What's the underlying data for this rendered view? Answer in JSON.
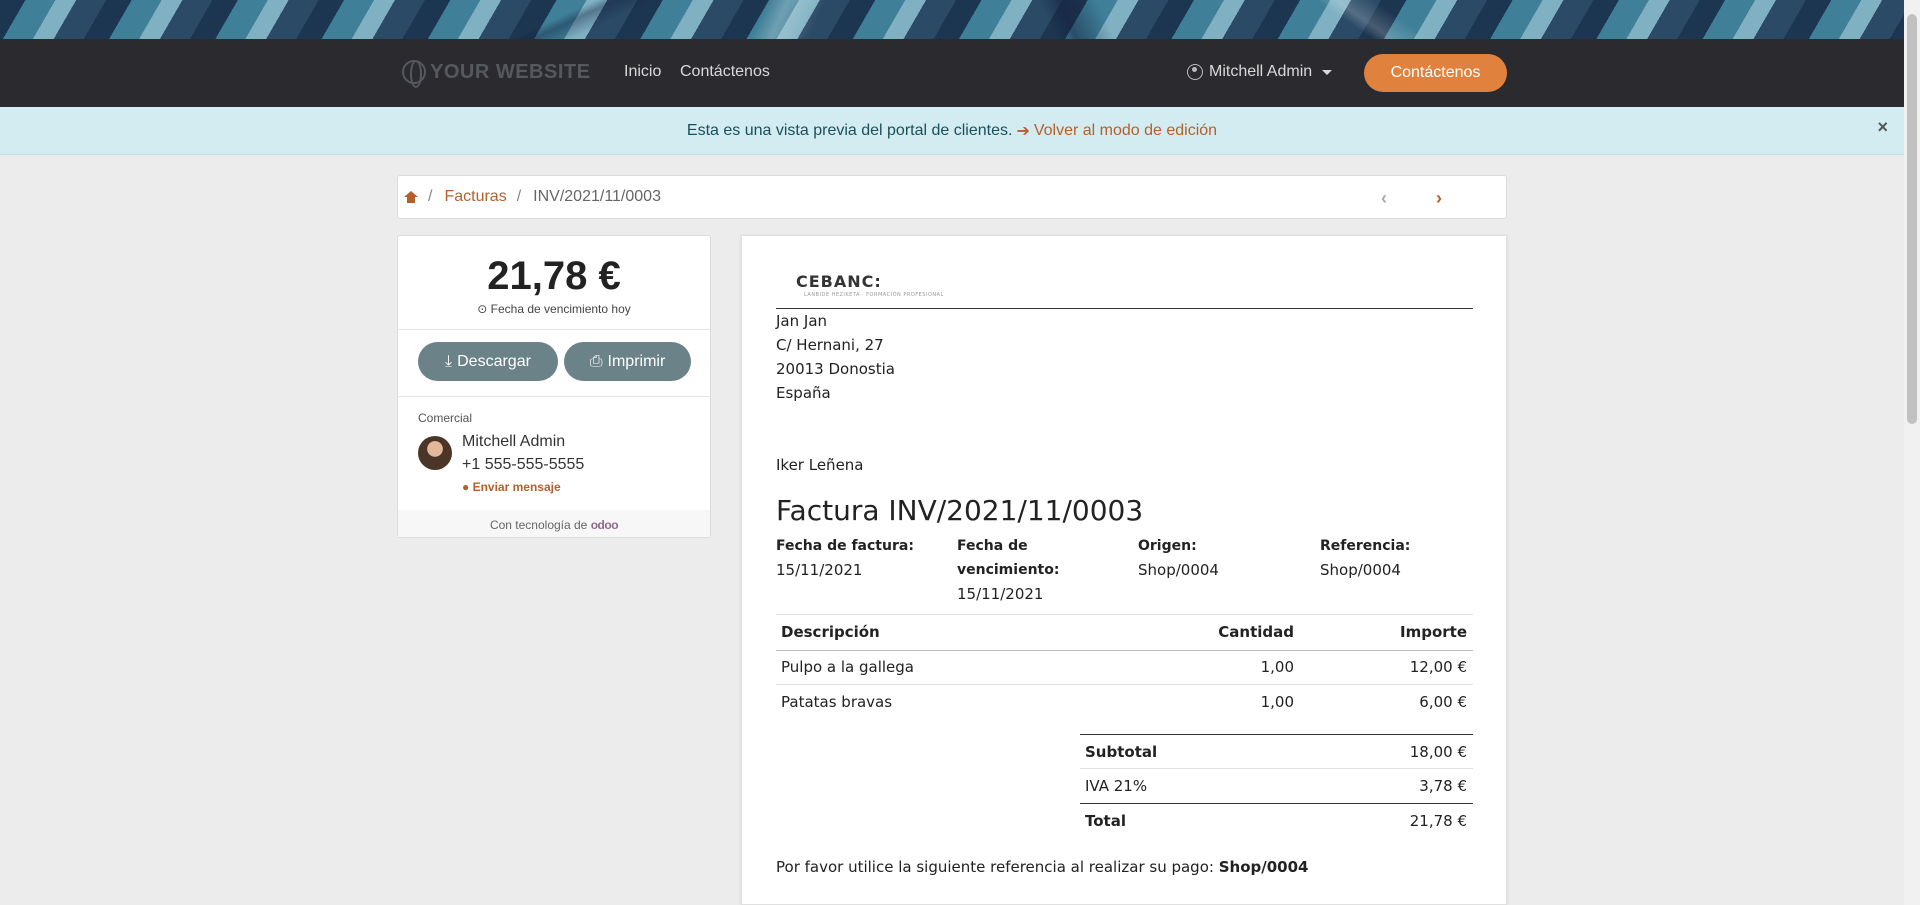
{
  "navbar": {
    "logo_text": "YOUR WEBSITE",
    "links": [
      "Inicio",
      "Contáctenos"
    ],
    "user_name": "Mitchell Admin",
    "cta_label": "Contáctenos"
  },
  "alert": {
    "text": "Esta es una vista previa del portal de clientes.",
    "link_text": "Volver al modo de edición",
    "close": "×"
  },
  "breadcrumb": {
    "sep": "/",
    "section": "Facturas",
    "current": "INV/2021/11/0003",
    "prev": "‹",
    "next": "›"
  },
  "sidebar": {
    "amount": "21,78 €",
    "due_text": "Fecha de vencimiento hoy",
    "download_label": "Descargar",
    "print_label": "Imprimir",
    "salesperson_heading": "Comercial",
    "salesperson_name": "Mitchell Admin",
    "salesperson_phone": "+1 555-555-5555",
    "message_label": "Enviar mensaje",
    "powered_by": "Con tecnología de",
    "powered_brand": "odoo"
  },
  "invoice": {
    "company_logo": "CEBANC:",
    "company_tagline": "LANBIDE HEZIKETA · FORMACIÓN PROFESIONAL",
    "company_address": [
      "Jan Jan",
      "C/ Hernani, 27",
      "20013 Donostia",
      "España"
    ],
    "customer": "Iker Leñena",
    "title": "Factura INV/2021/11/0003",
    "meta": {
      "invoice_date_label": "Fecha de factura:",
      "invoice_date": "15/11/2021",
      "due_date_label_1": "Fecha de",
      "due_date_label_2": "vencimiento:",
      "due_date": "15/11/2021",
      "origin_label": "Origen:",
      "origin": "Shop/0004",
      "reference_label": "Referencia:",
      "reference": "Shop/0004"
    },
    "columns": [
      "Descripción",
      "Cantidad",
      "Importe"
    ],
    "lines": [
      {
        "description": "Pulpo a la gallega",
        "quantity": "1,00",
        "amount": "12,00 €"
      },
      {
        "description": "Patatas bravas",
        "quantity": "1,00",
        "amount": "6,00 €"
      }
    ],
    "totals": {
      "subtotal_label": "Subtotal",
      "subtotal": "18,00 €",
      "tax_label": "IVA 21%",
      "tax": "3,78 €",
      "total_label": "Total",
      "total": "21,78 €"
    },
    "payment_note": "Por favor utilice la siguiente referencia al realizar su pago:",
    "payment_ref": "Shop/0004"
  },
  "colors": {
    "accent": "#e0823d",
    "link": "#b5602a",
    "navbar": "#2b2b2f",
    "button": "#6b8289"
  }
}
